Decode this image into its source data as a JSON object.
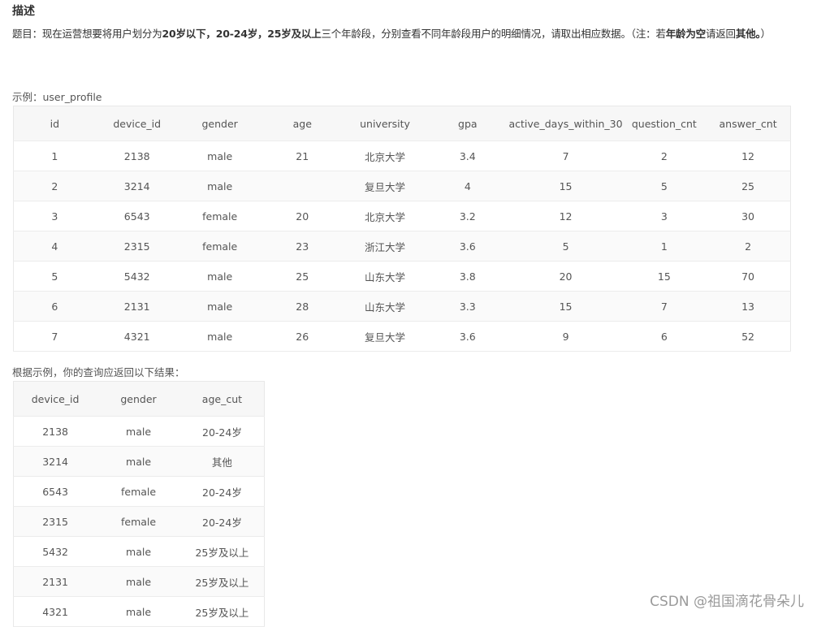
{
  "heading": "描述",
  "description": {
    "p1": "题目：现在运营想要将用户划分为",
    "b1": "20岁以下，20-24岁，25岁及以上",
    "p2": "三个年龄段，分别查看不同年龄段用户的明细情况，请取出相应数据。（注：若",
    "b2": "年龄为空",
    "p3": "请返回",
    "b3": "其他。",
    "p4": "）"
  },
  "example_caption": "示例：user_profile",
  "user_profile": {
    "headers": [
      "id",
      "device_id",
      "gender",
      "age",
      "university",
      "gpa",
      "active_days_within_30",
      "question_cnt",
      "answer_cnt"
    ],
    "rows": [
      [
        "1",
        "2138",
        "male",
        "21",
        "北京大学",
        "3.4",
        "7",
        "2",
        "12"
      ],
      [
        "2",
        "3214",
        "male",
        "",
        "复旦大学",
        "4",
        "15",
        "5",
        "25"
      ],
      [
        "3",
        "6543",
        "female",
        "20",
        "北京大学",
        "3.2",
        "12",
        "3",
        "30"
      ],
      [
        "4",
        "2315",
        "female",
        "23",
        "浙江大学",
        "3.6",
        "5",
        "1",
        "2"
      ],
      [
        "5",
        "5432",
        "male",
        "25",
        "山东大学",
        "3.8",
        "20",
        "15",
        "70"
      ],
      [
        "6",
        "2131",
        "male",
        "28",
        "山东大学",
        "3.3",
        "15",
        "7",
        "13"
      ],
      [
        "7",
        "4321",
        "male",
        "26",
        "复旦大学",
        "3.6",
        "9",
        "6",
        "52"
      ]
    ]
  },
  "result_caption": "根据示例，你的查询应返回以下结果：",
  "result": {
    "headers": [
      "device_id",
      "gender",
      "age_cut"
    ],
    "rows": [
      [
        "2138",
        "male",
        "20-24岁"
      ],
      [
        "3214",
        "male",
        "其他"
      ],
      [
        "6543",
        "female",
        "20-24岁"
      ],
      [
        "2315",
        "female",
        "20-24岁"
      ],
      [
        "5432",
        "male",
        "25岁及以上"
      ],
      [
        "2131",
        "male",
        "25岁及以上"
      ],
      [
        "4321",
        "male",
        "25岁及以上"
      ]
    ]
  },
  "watermark": "CSDN @祖国滴花骨朵儿"
}
